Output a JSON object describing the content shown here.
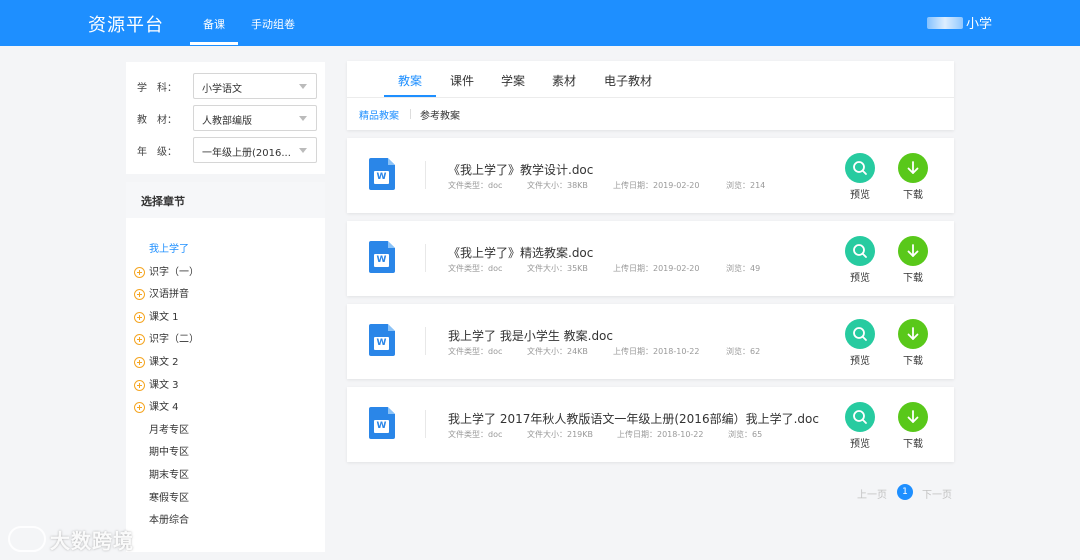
{
  "header": {
    "brand": "资源平台",
    "nav": [
      "备课",
      "手动组卷"
    ],
    "school": "小学"
  },
  "filters": [
    {
      "label": "学　科：",
      "value": "小学语文"
    },
    {
      "label": "教　材：",
      "value": "人教部编版"
    },
    {
      "label": "年　级：",
      "value": "一年级上册(2016..."
    }
  ],
  "chapters": {
    "title": "选择章节",
    "items": [
      {
        "label": "我上学了",
        "expandable": false,
        "active": true
      },
      {
        "label": "识字（一）",
        "expandable": true
      },
      {
        "label": "汉语拼音",
        "expandable": true
      },
      {
        "label": "课文 1",
        "expandable": true
      },
      {
        "label": "识字（二）",
        "expandable": true
      },
      {
        "label": "课文 2",
        "expandable": true
      },
      {
        "label": "课文 3",
        "expandable": true
      },
      {
        "label": "课文 4",
        "expandable": true
      },
      {
        "label": "月考专区",
        "expandable": false
      },
      {
        "label": "期中专区",
        "expandable": false
      },
      {
        "label": "期末专区",
        "expandable": false
      },
      {
        "label": "寒假专区",
        "expandable": false
      },
      {
        "label": "本册综合",
        "expandable": false
      }
    ]
  },
  "tabs": [
    "教案",
    "课件",
    "学案",
    "素材",
    "电子教材"
  ],
  "subtabs": [
    "精品教案",
    "参考教案"
  ],
  "files": [
    {
      "name": "《我上学了》教学设计.doc",
      "type": "文件类型：doc",
      "size": "文件大小：38KB",
      "date": "上传日期：2019-02-20",
      "views": "浏览：214"
    },
    {
      "name": "《我上学了》精选教案.doc",
      "type": "文件类型：doc",
      "size": "文件大小：35KB",
      "date": "上传日期：2019-02-20",
      "views": "浏览：49"
    },
    {
      "name": "我上学了 我是小学生 教案.doc",
      "type": "文件类型：doc",
      "size": "文件大小：24KB",
      "date": "上传日期：2018-10-22",
      "views": "浏览：62"
    },
    {
      "name": "我上学了 2017年秋人教版语文一年级上册(2016部编）我上学了.doc",
      "type": "文件类型：doc",
      "size": "文件大小：219KB",
      "date": "上传日期：2018-10-22",
      "views": "浏览：65"
    }
  ],
  "actions": {
    "preview": "预览",
    "download": "下载"
  },
  "doc_icon_letter": "W",
  "pagination": {
    "prev": "上一页",
    "current": "1",
    "next": "下一页"
  },
  "watermark": "大数跨境",
  "colors": {
    "primary": "#1e8fff",
    "preview": "#27cba0",
    "download": "#59c81a",
    "expand": "#f5a623"
  }
}
